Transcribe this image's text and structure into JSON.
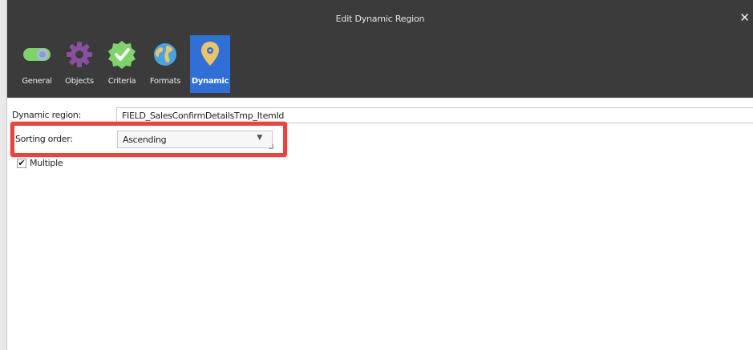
{
  "window": {
    "title": "Edit Dynamic Region",
    "close_glyph": "✕"
  },
  "tabs": [
    {
      "label": "General",
      "icon": "toggle-icon"
    },
    {
      "label": "Objects",
      "icon": "gear-icon"
    },
    {
      "label": "Criteria",
      "icon": "checkmark-badge-icon"
    },
    {
      "label": "Formats",
      "icon": "globe-icon"
    },
    {
      "label": "Dynamic",
      "icon": "map-pin-icon",
      "active": true
    }
  ],
  "form": {
    "dynamic_region_label": "Dynamic region:",
    "dynamic_region_value": "FIELD_SalesConfirmDetailsTmp_ItemId",
    "sorting_order_label": "Sorting order:",
    "sorting_order_value": "Ascending",
    "dropdown_arrow": "▼",
    "multiple_label": "Multiple",
    "multiple_checked": true,
    "check_glyph": "✔"
  },
  "colors": {
    "titlebar": "#3b3b3b",
    "active_tab": "#2f6fd6",
    "highlight": "#e7443f",
    "general_icon": "#7fd36b",
    "objects_icon": "#8a4f9e",
    "criteria_icon": "#7fd36b",
    "formats_icon": "#4aa3e0",
    "dynamic_icon": "#e9c46a"
  }
}
